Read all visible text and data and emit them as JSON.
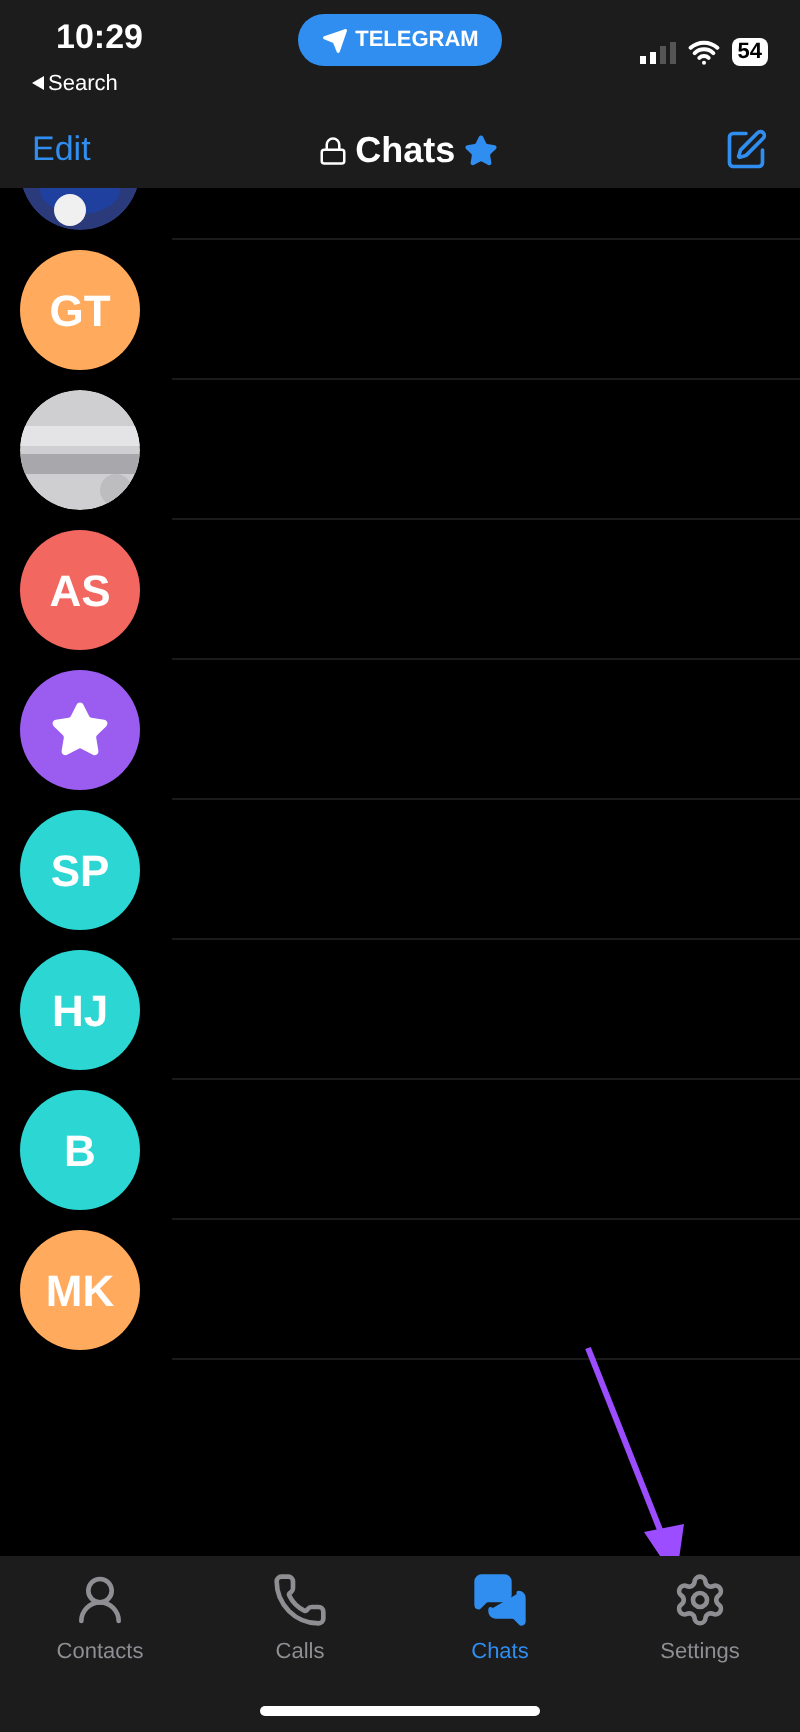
{
  "status_bar": {
    "time": "10:29",
    "back_label": "Search",
    "app_pill": "TELEGRAM",
    "battery": "54"
  },
  "nav": {
    "edit": "Edit",
    "title": "Chats"
  },
  "chats": [
    {
      "kind": "picture"
    },
    {
      "kind": "initials",
      "initials": "GT",
      "color": "#ffaa5c"
    },
    {
      "kind": "picture"
    },
    {
      "kind": "initials",
      "initials": "AS",
      "color": "#f2675f"
    },
    {
      "kind": "saved",
      "color": "#9b5cf0"
    },
    {
      "kind": "initials",
      "initials": "SP",
      "color": "#2cd6d3"
    },
    {
      "kind": "initials",
      "initials": "HJ",
      "color": "#2cd6d3"
    },
    {
      "kind": "initials",
      "initials": "B",
      "color": "#2cd6d3"
    },
    {
      "kind": "initials",
      "initials": "MK",
      "color": "#ffaa5c"
    }
  ],
  "tabs": [
    {
      "label": "Contacts",
      "selected": false
    },
    {
      "label": "Calls",
      "selected": false
    },
    {
      "label": "Chats",
      "selected": true
    },
    {
      "label": "Settings",
      "selected": false
    }
  ]
}
